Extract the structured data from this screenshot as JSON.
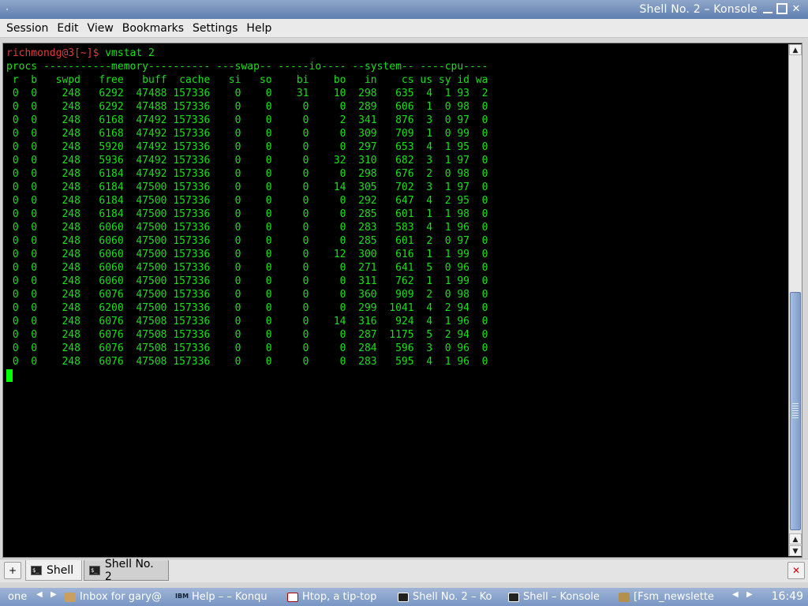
{
  "window": {
    "title": "Shell No. 2 – Konsole",
    "menu_dot": "·"
  },
  "menubar": {
    "items": [
      "Session",
      "Edit",
      "View",
      "Bookmarks",
      "Settings",
      "Help"
    ]
  },
  "terminal": {
    "prompt": "richmondg@3[~]$ ",
    "command": "vmstat 2",
    "header1": "procs -----------memory---------- ---swap-- -----io---- --system-- ----cpu----",
    "header2": " r  b   swpd   free   buff  cache   si   so    bi    bo   in    cs us sy id wa",
    "rows": [
      " 0  0    248   6292  47488 157336    0    0    31    10  298   635  4  1 93  2",
      " 0  0    248   6292  47488 157336    0    0     0     0  289   606  1  0 98  0",
      " 0  0    248   6168  47492 157336    0    0     0     2  341   876  3  0 97  0",
      " 0  0    248   6168  47492 157336    0    0     0     0  309   709  1  0 99  0",
      " 0  0    248   5920  47492 157336    0    0     0     0  297   653  4  1 95  0",
      " 0  0    248   5936  47492 157336    0    0     0    32  310   682  3  1 97  0",
      " 0  0    248   6184  47492 157336    0    0     0     0  298   676  2  0 98  0",
      " 0  0    248   6184  47500 157336    0    0     0    14  305   702  3  1 97  0",
      " 0  0    248   6184  47500 157336    0    0     0     0  292   647  4  2 95  0",
      " 0  0    248   6184  47500 157336    0    0     0     0  285   601  1  1 98  0",
      " 0  0    248   6060  47500 157336    0    0     0     0  283   583  4  1 96  0",
      " 0  0    248   6060  47500 157336    0    0     0     0  285   601  2  0 97  0",
      " 0  0    248   6060  47500 157336    0    0     0    12  300   616  1  1 99  0",
      " 0  0    248   6060  47500 157336    0    0     0     0  271   641  5  0 96  0",
      " 0  0    248   6060  47500 157336    0    0     0     0  311   762  1  1 99  0",
      " 0  0    248   6076  47500 157336    0    0     0     0  360   909  2  0 98  0",
      " 0  0    248   6200  47500 157336    0    0     0     0  299  1041  4  2 94  0",
      " 0  0    248   6076  47508 157336    0    0     0    14  316   924  4  1 96  0",
      " 0  0    248   6076  47508 157336    0    0     0     0  287  1175  5  2 94  0",
      " 0  0    248   6076  47508 157336    0    0     0     0  284   596  3  0 96  0",
      " 0  0    248   6076  47508 157336    0    0     0     0  283   595  4  1 96  0"
    ],
    "colors": {
      "text": "#18e018",
      "prompt": "#e23a3a",
      "background": "#000000"
    }
  },
  "tabs": {
    "items": [
      {
        "label": "Shell",
        "icon": "terminal-icon"
      },
      {
        "label": "Shell No. 2",
        "icon": "terminal-icon"
      }
    ],
    "active_index": 1
  },
  "taskbar": {
    "items": [
      {
        "label": "one",
        "icon": ""
      },
      {
        "label": "Inbox for gary@",
        "icon": "mail-icon"
      },
      {
        "label": "Help – – Konqu",
        "icon": "ibm-icon"
      },
      {
        "label": "Htop, a tip-top",
        "icon": "htop-icon"
      },
      {
        "label": "Shell No. 2 – Ko",
        "icon": "terminal-icon"
      },
      {
        "label": "Shell – Konsole",
        "icon": "terminal-icon"
      },
      {
        "label": "[Fsm_newslette",
        "icon": "gear-icon"
      }
    ],
    "clock": "16:49",
    "ibm_text": "IBM"
  }
}
